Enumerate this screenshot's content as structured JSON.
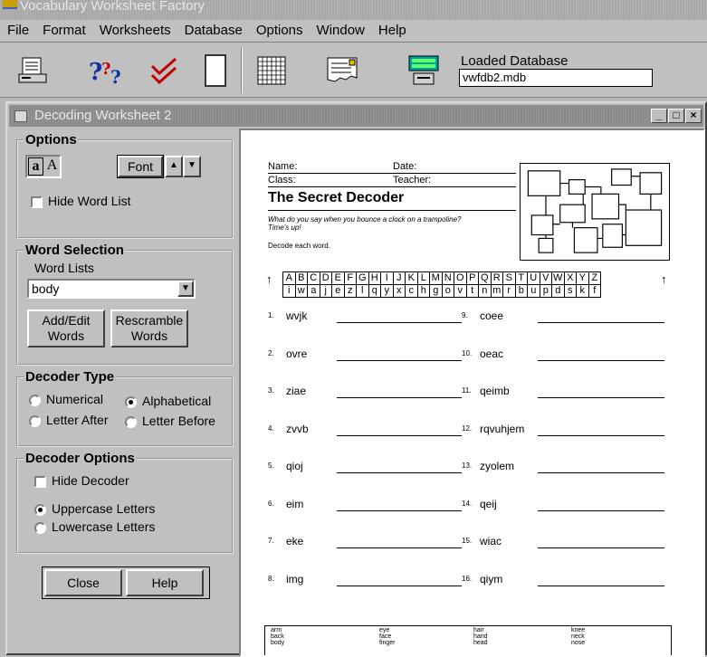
{
  "app": {
    "title": "Vocabulary Worksheet Factory"
  },
  "menu": [
    {
      "label": "File"
    },
    {
      "label": "Format"
    },
    {
      "label": "Worksheets"
    },
    {
      "label": "Database"
    },
    {
      "label": "Options"
    },
    {
      "label": "Window"
    },
    {
      "label": "Help"
    }
  ],
  "toolbar": {
    "buttons": [
      "printer-icon",
      "question-marks-icon",
      "checkmarks-icon",
      "blank-page-icon",
      "grid-icon",
      "torn-page-icon",
      "database-icon"
    ],
    "db_label": "Loaded Database",
    "db_value": "vwfdb2.mdb"
  },
  "window": {
    "title": "Decoding Worksheet 2",
    "controls": {
      "minimize": "_",
      "restore": "□",
      "close": "×"
    }
  },
  "options": {
    "title": "Options",
    "case_lower": "a",
    "case_upper": "A",
    "font_button": "Font",
    "hide_word_list": "Hide Word List"
  },
  "word_selection": {
    "title": "Word Selection",
    "lists_label": "Word Lists",
    "selected_list": "body",
    "add_edit": [
      "Add/Edit",
      "Words"
    ],
    "rescramble": [
      "Rescramble",
      "Words"
    ]
  },
  "decoder_type": {
    "title": "Decoder Type",
    "numerical": "Numerical",
    "alphabetical": "Alphabetical",
    "letter_after": "Letter After",
    "letter_before": "Letter Before",
    "selected": "alphabetical"
  },
  "decoder_options": {
    "title": "Decoder Options",
    "hide_decoder": "Hide Decoder",
    "uppercase": "Uppercase Letters",
    "lowercase": "Lowercase Letters",
    "selected": "uppercase"
  },
  "buttons": {
    "close": "Close",
    "help": "Help"
  },
  "worksheet": {
    "name_label": "Name:",
    "date_label": "Date:",
    "class_label": "Class:",
    "teacher_label": "Teacher:",
    "title": "The Secret Decoder",
    "riddle": "What do you say when you bounce a clock on a trampoline? Time's up!",
    "instructions": "Decode each word.",
    "key_top": [
      "A",
      "B",
      "C",
      "D",
      "E",
      "F",
      "G",
      "H",
      "I",
      "J",
      "K",
      "L",
      "M",
      "N",
      "O",
      "P",
      "Q",
      "R",
      "S",
      "T",
      "U",
      "V",
      "W",
      "X",
      "Y",
      "Z"
    ],
    "key_bottom": [
      "i",
      "w",
      "a",
      "j",
      "e",
      "z",
      "l",
      "q",
      "y",
      "x",
      "c",
      "h",
      "g",
      "o",
      "v",
      "t",
      "n",
      "m",
      "r",
      "b",
      "u",
      "p",
      "d",
      "s",
      "k",
      "f"
    ],
    "questions_left": [
      {
        "n": "1.",
        "w": "wvjk"
      },
      {
        "n": "2.",
        "w": "ovre"
      },
      {
        "n": "3.",
        "w": "ziae"
      },
      {
        "n": "4.",
        "w": "zvvb"
      },
      {
        "n": "5.",
        "w": "qioj"
      },
      {
        "n": "6.",
        "w": "eim"
      },
      {
        "n": "7.",
        "w": "eke"
      },
      {
        "n": "8.",
        "w": "img"
      }
    ],
    "questions_right": [
      {
        "n": "9.",
        "w": "coee"
      },
      {
        "n": "10.",
        "w": "oeac"
      },
      {
        "n": "11.",
        "w": "qeimb"
      },
      {
        "n": "12.",
        "w": "rqvuhjem"
      },
      {
        "n": "13.",
        "w": "zyolem"
      },
      {
        "n": "14.",
        "w": "qeij"
      },
      {
        "n": "15.",
        "w": "wiac"
      },
      {
        "n": "16.",
        "w": "qiym"
      }
    ],
    "word_list_cols": [
      [
        "arm",
        "back",
        "body"
      ],
      [
        "eye",
        "face",
        "finger"
      ],
      [
        "hair",
        "hand",
        "head"
      ],
      [
        "knee",
        "neck",
        "nose"
      ]
    ]
  }
}
